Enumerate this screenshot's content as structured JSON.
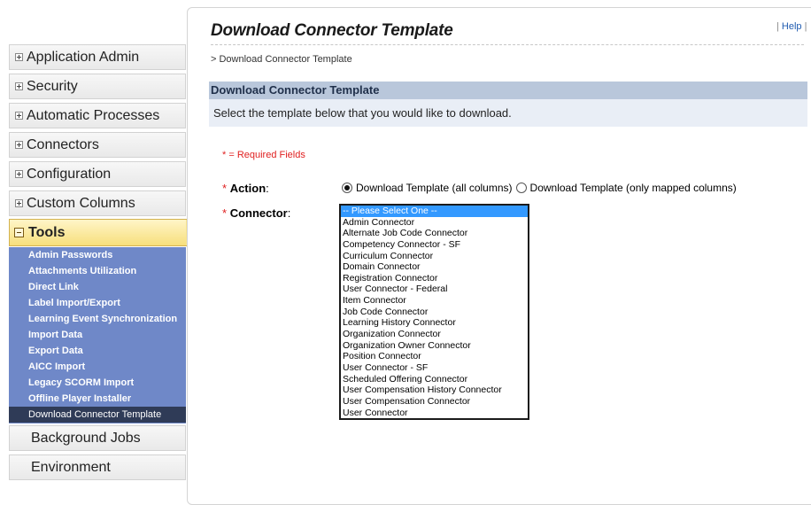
{
  "sidebar": {
    "items": [
      {
        "label": "Application Admin",
        "sign": "plus"
      },
      {
        "label": "Security",
        "sign": "plus"
      },
      {
        "label": "Automatic Processes",
        "sign": "plus"
      },
      {
        "label": "Connectors",
        "sign": "plus"
      },
      {
        "label": "Configuration",
        "sign": "plus"
      },
      {
        "label": "Custom Columns",
        "sign": "plus"
      }
    ],
    "tools": {
      "label": "Tools",
      "sub_items": [
        "Admin Passwords",
        "Attachments Utilization",
        "Direct Link",
        "Label Import/Export",
        "Learning Event Synchronization",
        "Import Data",
        "Export Data",
        "AICC Import",
        "Legacy SCORM Import",
        "Offline Player Installer",
        "Download Connector Template"
      ],
      "active_sub_item": "Download Connector Template"
    },
    "after_items": [
      {
        "label": "Background Jobs"
      },
      {
        "label": "Environment"
      }
    ]
  },
  "header": {
    "title": "Download Connector Template",
    "help_prefix": "| ",
    "help_label": "Help",
    "help_suffix": " |",
    "breadcrumb": "> Download Connector Template"
  },
  "section": {
    "title": "Download Connector Template",
    "description": "Select the template below that you would like to download."
  },
  "form": {
    "required_note": "* = Required Fields",
    "star": "*",
    "action_label": "Action",
    "action_colon": ":",
    "connector_label": "Connector",
    "connector_colon": ":",
    "action_options": [
      {
        "label": "Download Template (all columns)",
        "selected": true
      },
      {
        "label": "Download Template (only mapped columns)",
        "selected": false
      }
    ],
    "connector_options": [
      "-- Please Select One --",
      "Admin Connector",
      "Alternate Job Code Connector",
      "Competency Connector - SF",
      "Curriculum Connector",
      "Domain Connector",
      "Registration Connector",
      "User Connector - Federal",
      "Item Connector",
      "Job Code Connector",
      "Learning History Connector",
      "Organization Connector",
      "Organization Owner Connector",
      "Position Connector",
      "User Connector - SF",
      "Scheduled Offering Connector",
      "User Compensation History Connector",
      "User Compensation Connector",
      "User Connector"
    ],
    "connector_selected": "-- Please Select One --"
  }
}
